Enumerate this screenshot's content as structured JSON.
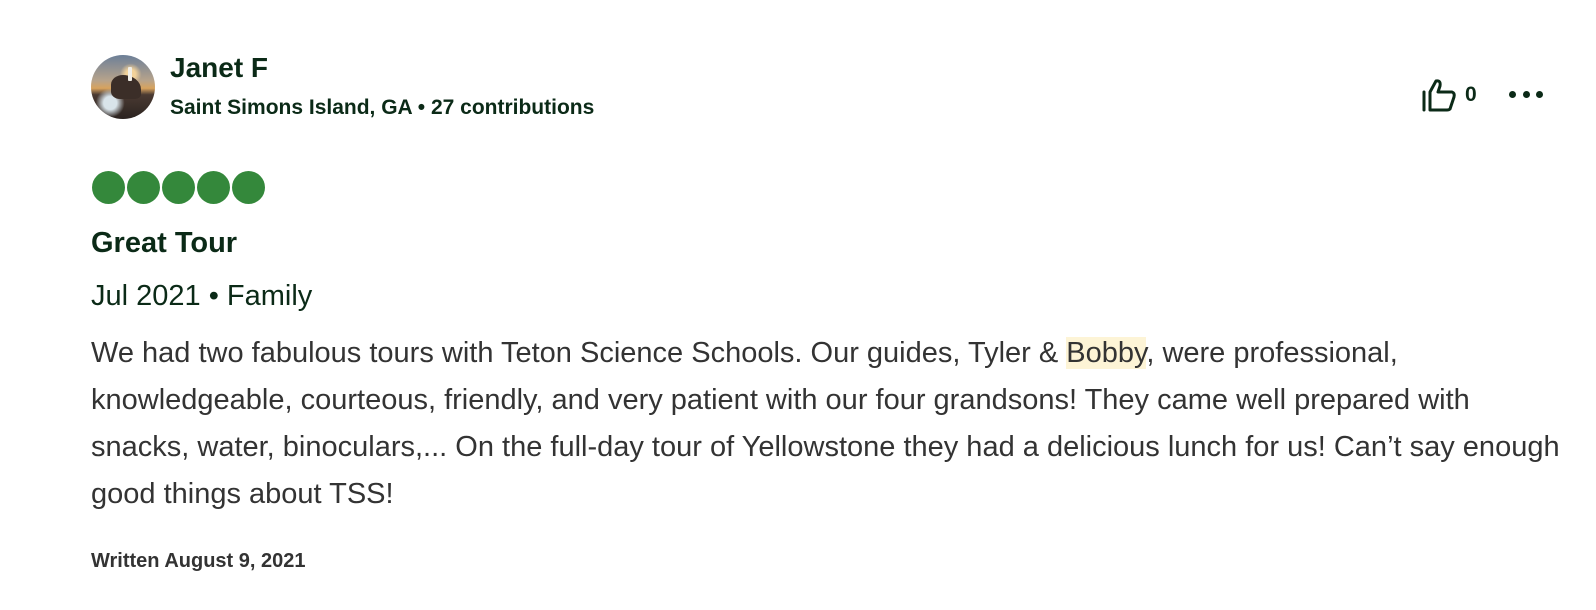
{
  "review": {
    "author": {
      "name": "Janet F",
      "meta": "Saint Simons Island, GA • 27 contributions",
      "avatar_icon": "profile-photo-coastal-lighthouse"
    },
    "helpful": {
      "icon": "thumbs-up-icon",
      "count": "0"
    },
    "more_icon": "more-options-icon",
    "rating": {
      "value": 5,
      "max": 5,
      "color": "#34883b"
    },
    "title": "Great Tour",
    "trip": "Jul 2021 • Family",
    "body": {
      "before_highlight": "We had two fabulous tours with Teton Science Schools. Our guides, Tyler & ",
      "highlight": "Bobby",
      "after_highlight": ", were professional, knowledgeable, courteous, friendly, and very patient with our four grandsons! They came well prepared with snacks, water, binoculars,... On the full-day tour of Yellowstone they had a delicious lunch for us! Can’t say enough good things about TSS!"
    },
    "written": "Written August 9, 2021"
  }
}
